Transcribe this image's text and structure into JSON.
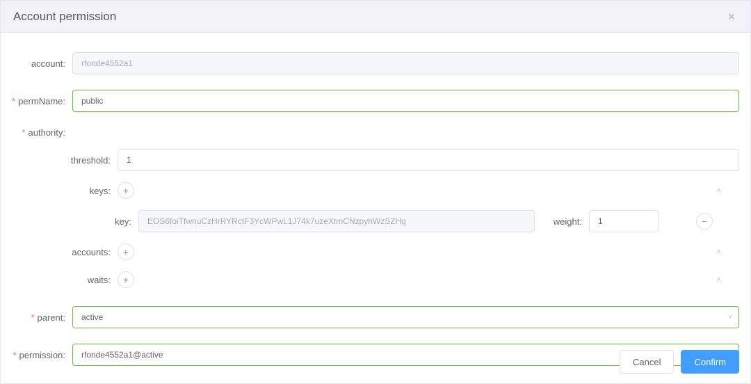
{
  "header": {
    "title": "Account permission"
  },
  "form": {
    "account": {
      "label": "account:",
      "value": "rfonde4552a1"
    },
    "permName": {
      "label": "permName:",
      "value": "public"
    },
    "authority": {
      "label": "authority:",
      "threshold": {
        "label": "threshold:",
        "value": "1"
      },
      "keys": {
        "label": "keys:",
        "items": [
          {
            "keyLabel": "key:",
            "key": "EOS6foiTfwnuCzHrRYRctF3YcWPwL1J74k7uzeXtmCNzpyhWzSZHg",
            "weightLabel": "weight:",
            "weight": "1"
          }
        ]
      },
      "accounts": {
        "label": "accounts:"
      },
      "waits": {
        "label": "waits:"
      }
    },
    "parent": {
      "label": "parent:",
      "value": "active"
    },
    "permission": {
      "label": "permission:",
      "value": "rfonde4552a1@active"
    }
  },
  "footer": {
    "cancel": "Cancel",
    "confirm": "Confirm"
  },
  "icons": {
    "plus": "+",
    "minus": "−",
    "close": "×",
    "caret_up": "˄",
    "caret_down": "˅"
  }
}
